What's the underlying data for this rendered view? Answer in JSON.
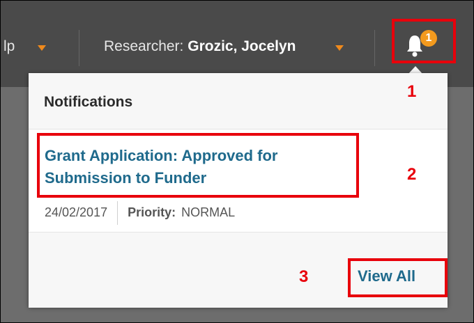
{
  "topbar": {
    "help_label": "lp",
    "researcher_prefix": "Researcher:",
    "researcher_name": "Grozic, Jocelyn"
  },
  "notifications": {
    "badge_count": "1",
    "title": "Notifications",
    "items": [
      {
        "title": "Grant Application: Approved for Submission to Funder",
        "date": "24/02/2017",
        "priority_label": "Priority:",
        "priority_value": "NORMAL"
      }
    ],
    "view_all_label": "View All"
  },
  "annotations": {
    "marker_1": "1",
    "marker_2": "2",
    "marker_3": "3",
    "highlight_color": "#e8000b"
  },
  "colors": {
    "topbar_bg": "#4a4a4a",
    "accent_orange": "#f39a1e",
    "link_blue": "#1f6a8c"
  },
  "icons": {
    "bell": "bell-icon",
    "caret": "chevron-down-icon"
  }
}
